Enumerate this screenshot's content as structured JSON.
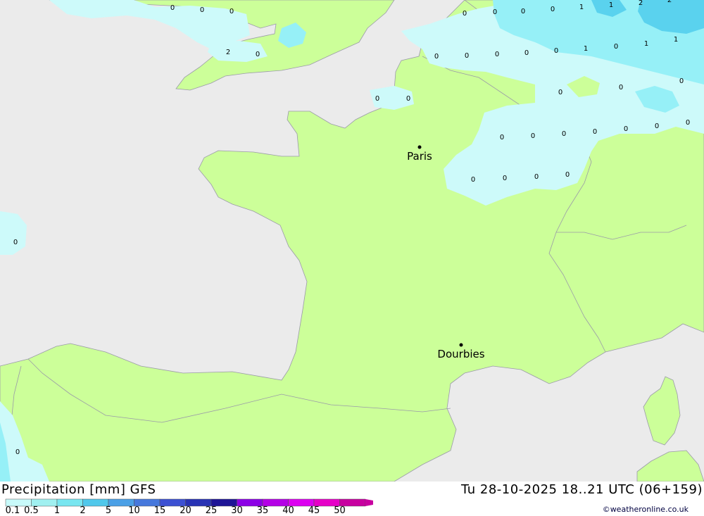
{
  "map": {
    "cities": [
      {
        "name": "Paris"
      },
      {
        "name": "Dourbies"
      }
    ],
    "value_labels": [
      "0",
      "0",
      "0",
      "0",
      "0",
      "0",
      "0",
      "1",
      "1",
      "2",
      "2",
      "2",
      "0",
      "0",
      "0",
      "0",
      "0",
      "0",
      "1",
      "0",
      "1",
      "1",
      "0",
      "0",
      "0",
      "0",
      "0",
      "0",
      "0",
      "0",
      "0",
      "0",
      "0",
      "0",
      "0",
      "0",
      "0",
      "0",
      "0",
      "0",
      "0"
    ]
  },
  "footer": {
    "title": "Precipitation [mm] GFS",
    "valid_time": "Tu 28-10-2025 18..21 UTC (06+159)",
    "credit": "©weatheronline.co.uk"
  },
  "legend": {
    "ticks": [
      "0.1",
      "0.5",
      "1",
      "2",
      "5",
      "10",
      "15",
      "20",
      "25",
      "30",
      "35",
      "40",
      "45",
      "50"
    ],
    "colors": [
      "#c8fafa",
      "#a0f0f0",
      "#78e6f0",
      "#50c8eb",
      "#4ba0e6",
      "#4678dc",
      "#3c50d2",
      "#2832b4",
      "#1e1496",
      "#8c00e6",
      "#b400e6",
      "#dc00f0",
      "#e600c8",
      "#c800a0"
    ]
  },
  "colors": {
    "land": "#ccff99",
    "sea": "#ebebeb",
    "rain_light": "#cdfafa",
    "rain_medium": "#96f0f7",
    "rain_heavy": "#5ad2ee",
    "border": "#9a9aa8"
  }
}
